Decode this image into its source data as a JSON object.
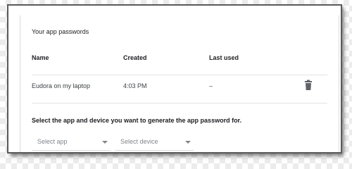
{
  "section_title": "Your app passwords",
  "table": {
    "columns": [
      "Name",
      "Created",
      "Last used"
    ],
    "rows": [
      {
        "name": "Eudora on my laptop",
        "created": "4:03 PM",
        "last_used": "–",
        "action_icon": "trash-icon"
      }
    ]
  },
  "generate": {
    "prompt": "Select the app and device you want to generate the app password for.",
    "app_select": {
      "placeholder": "Select app",
      "icon": "caret-down-icon"
    },
    "device_select": {
      "placeholder": "Select device",
      "icon": "caret-down-icon"
    }
  },
  "colors": {
    "text_primary": "#202124",
    "text_secondary": "#80868b",
    "icon": "#5f6368"
  }
}
